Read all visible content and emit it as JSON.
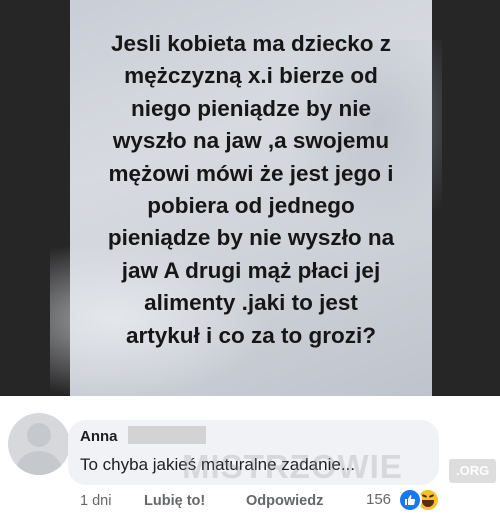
{
  "post": {
    "text": "Jesli kobieta ma dziecko z\nmężczyzną x.i bierze od\nniego pieniądze by nie\nwyszło na jaw ,a swojemu\nmężowi mówi że jest jego i\npobiera od jednego\npieniądze by nie wyszło na\njaw A drugi  mąż płaci jej\nalimenty .jaki to jest\nartykuł i co za to grozi?"
  },
  "comment": {
    "author": "Anna",
    "text": "To chyba jakieś maturalne zadanie...",
    "time": "1 dni",
    "like_label": "Lubię to!",
    "reply_label": "Odpowiedz",
    "reaction_count": "156",
    "reactions": [
      "like-icon",
      "haha-icon"
    ]
  },
  "watermark": {
    "text": "MISTRZOWIE",
    "suffix": ".ORG"
  },
  "colors": {
    "story_background": "#262627",
    "bubble": "#f0f2f5",
    "like_blue": "#1877f2",
    "haha_yellow": "#f7c229",
    "secondary_text": "#65676b"
  }
}
